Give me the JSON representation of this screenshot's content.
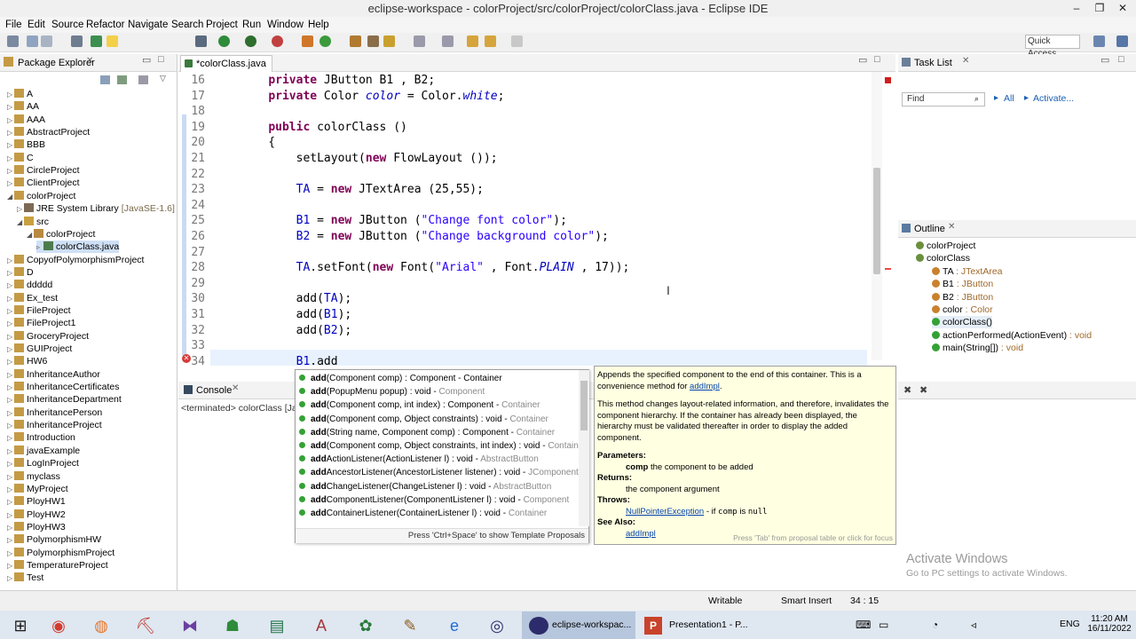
{
  "window": {
    "title": "eclipse-workspace - colorProject/src/colorProject/colorClass.java - Eclipse IDE",
    "minimize": "–",
    "maximize": "❐",
    "close": "✕"
  },
  "menu": [
    "File",
    "Edit",
    "Source",
    "Refactor",
    "Navigate",
    "Search",
    "Project",
    "Run",
    "Window",
    "Help"
  ],
  "quick_access": "Quick Access",
  "package_explorer": {
    "title": "Package Explorer",
    "items": [
      {
        "label": "A",
        "indent": 0,
        "kind": "project"
      },
      {
        "label": "AA",
        "indent": 0,
        "kind": "project"
      },
      {
        "label": "AAA",
        "indent": 0,
        "kind": "project"
      },
      {
        "label": "AbstractProject",
        "indent": 0,
        "kind": "project"
      },
      {
        "label": "BBB",
        "indent": 0,
        "kind": "project"
      },
      {
        "label": "C",
        "indent": 0,
        "kind": "project"
      },
      {
        "label": "CircleProject",
        "indent": 0,
        "kind": "project"
      },
      {
        "label": "ClientProject",
        "indent": 0,
        "kind": "project"
      },
      {
        "label": "colorProject",
        "indent": 0,
        "kind": "project",
        "open": true
      },
      {
        "label": "JRE System Library",
        "suffix": "[JavaSE-1.6]",
        "indent": 1,
        "kind": "lib"
      },
      {
        "label": "src",
        "indent": 1,
        "kind": "src",
        "open": true
      },
      {
        "label": "colorProject",
        "indent": 2,
        "kind": "pkg",
        "open": true
      },
      {
        "label": "colorClass.java",
        "indent": 3,
        "kind": "file"
      },
      {
        "label": "CopyofPolymorphismProject",
        "indent": 0,
        "kind": "project"
      },
      {
        "label": "D",
        "indent": 0,
        "kind": "project"
      },
      {
        "label": "ddddd",
        "indent": 0,
        "kind": "project"
      },
      {
        "label": "Ex_test",
        "indent": 0,
        "kind": "project"
      },
      {
        "label": "FileProject",
        "indent": 0,
        "kind": "project"
      },
      {
        "label": "FileProject1",
        "indent": 0,
        "kind": "project"
      },
      {
        "label": "GroceryProject",
        "indent": 0,
        "kind": "project"
      },
      {
        "label": "GUIProject",
        "indent": 0,
        "kind": "project"
      },
      {
        "label": "HW6",
        "indent": 0,
        "kind": "project"
      },
      {
        "label": "InheritanceAuthor",
        "indent": 0,
        "kind": "project"
      },
      {
        "label": "InheritanceCertificates",
        "indent": 0,
        "kind": "project"
      },
      {
        "label": "InheritanceDepartment",
        "indent": 0,
        "kind": "project"
      },
      {
        "label": "InheritancePerson",
        "indent": 0,
        "kind": "project"
      },
      {
        "label": "InheritanceProject",
        "indent": 0,
        "kind": "project"
      },
      {
        "label": "Introduction",
        "indent": 0,
        "kind": "project"
      },
      {
        "label": "javaExample",
        "indent": 0,
        "kind": "project"
      },
      {
        "label": "LogInProject",
        "indent": 0,
        "kind": "project"
      },
      {
        "label": "myclass",
        "indent": 0,
        "kind": "project"
      },
      {
        "label": "MyProject",
        "indent": 0,
        "kind": "project"
      },
      {
        "label": "PloyHW1",
        "indent": 0,
        "kind": "project"
      },
      {
        "label": "PloyHW2",
        "indent": 0,
        "kind": "project"
      },
      {
        "label": "PloyHW3",
        "indent": 0,
        "kind": "project"
      },
      {
        "label": "PolymorphismHW",
        "indent": 0,
        "kind": "project"
      },
      {
        "label": "PolymorphismProject",
        "indent": 0,
        "kind": "project"
      },
      {
        "label": "TemperatureProject",
        "indent": 0,
        "kind": "project"
      },
      {
        "label": "Test",
        "indent": 0,
        "kind": "project"
      }
    ]
  },
  "editor": {
    "tab": "*colorClass.java",
    "lines": [
      {
        "n": "16",
        "html": "    <span class='kw'>private</span> JButton B1 , B2;"
      },
      {
        "n": "17",
        "html": "    <span class='kw'>private</span> Color <span class='fld'>color</span> = Color.<span class='fld'>white</span>;"
      },
      {
        "n": "18",
        "html": ""
      },
      {
        "n": "19",
        "html": "    <span class='kw'>public</span> colorClass ()"
      },
      {
        "n": "20",
        "html": "    {"
      },
      {
        "n": "21",
        "html": "        setLayout(<span class='kw'>new</span> FlowLayout ());"
      },
      {
        "n": "22",
        "html": ""
      },
      {
        "n": "23",
        "html": "        <span class='fld' style='font-style:normal'>TA</span> = <span class='kw'>new</span> JTextArea (25,55);"
      },
      {
        "n": "24",
        "html": ""
      },
      {
        "n": "25",
        "html": "        <span class='fld' style='font-style:normal'>B1</span> = <span class='kw'>new</span> JButton (<span class='str'>\"Change font color\"</span>);"
      },
      {
        "n": "26",
        "html": "        <span class='fld' style='font-style:normal'>B2</span> = <span class='kw'>new</span> JButton (<span class='str'>\"Change background color\"</span>);"
      },
      {
        "n": "27",
        "html": ""
      },
      {
        "n": "28",
        "html": "        <span class='fld' style='font-style:normal'>TA</span>.setFont(<span class='kw'>new</span> Font(<span class='str'>\"Arial\"</span> , Font.<span class='fld'>PLAIN</span> , 17));"
      },
      {
        "n": "29",
        "html": ""
      },
      {
        "n": "30",
        "html": "        add(<span class='fld' style='font-style:normal'>TA</span>);"
      },
      {
        "n": "31",
        "html": "        add(<span class='fld' style='font-style:normal'>B1</span>);"
      },
      {
        "n": "32",
        "html": "        add(<span class='fld' style='font-style:normal'>B2</span>);"
      },
      {
        "n": "33",
        "html": ""
      },
      {
        "n": "34",
        "html": "        <span class='fld' style='font-style:normal'>B1</span>.add"
      }
    ]
  },
  "console": {
    "title": "Console",
    "status": "<terminated> colorClass [Jav"
  },
  "task_list": {
    "title": "Task List",
    "find_placeholder": "Find",
    "all": "All",
    "activate": "Activate..."
  },
  "outline": {
    "title": "Outline",
    "items": [
      {
        "label": "colorProject",
        "type": "",
        "indent": 0
      },
      {
        "label": "colorClass",
        "type": "",
        "indent": 0
      },
      {
        "label": "TA",
        "type": " : JTextArea",
        "indent": 1
      },
      {
        "label": "B1",
        "type": " : JButton",
        "indent": 1
      },
      {
        "label": "B2",
        "type": " : JButton",
        "indent": 1
      },
      {
        "label": "color",
        "type": " : Color",
        "indent": 1
      },
      {
        "label": "colorClass()",
        "type": "",
        "indent": 1
      },
      {
        "label": "actionPerformed(ActionEvent)",
        "type": " : void",
        "indent": 1
      },
      {
        "label": "main(String[])",
        "type": " : void",
        "indent": 1
      }
    ]
  },
  "content_assist": {
    "proposals": [
      {
        "b": "add",
        "rest": "(Component comp) : Component - Container",
        "typ": ""
      },
      {
        "b": "add",
        "rest": "(PopupMenu popup) : void - ",
        "typ": "Component"
      },
      {
        "b": "add",
        "rest": "(Component comp, int index) : Component - ",
        "typ": "Container"
      },
      {
        "b": "add",
        "rest": "(Component comp, Object constraints) : void - ",
        "typ": "Container"
      },
      {
        "b": "add",
        "rest": "(String name, Component comp) : Component - ",
        "typ": "Container"
      },
      {
        "b": "add",
        "rest": "(Component comp, Object constraints, int index) : void - ",
        "typ": "Container"
      },
      {
        "b": "add",
        "rest": "ActionListener(ActionListener l) : void - ",
        "typ": "AbstractButton"
      },
      {
        "b": "add",
        "rest": "AncestorListener(AncestorListener listener) : void - ",
        "typ": "JComponent"
      },
      {
        "b": "add",
        "rest": "ChangeListener(ChangeListener l) : void - ",
        "typ": "AbstractButton"
      },
      {
        "b": "add",
        "rest": "ComponentListener(ComponentListener l) : void - ",
        "typ": "Component"
      },
      {
        "b": "add",
        "rest": "ContainerListener(ContainerListener l) : void - ",
        "typ": "Container"
      }
    ],
    "footer": "Press 'Ctrl+Space' to show Template Proposals"
  },
  "javadoc": {
    "p1": "Appends the specified component to the end of this container. This is a convenience method for ",
    "p1_link": "addImpl",
    "p2": "This method changes layout-related information, and therefore, invalidates the component hierarchy. If the container has already been displayed, the hierarchy must be validated thereafter in order to display the added component.",
    "params_h": "Parameters:",
    "param": "comp",
    "param_desc": " the component to be added",
    "returns_h": "Returns:",
    "returns": "the component argument",
    "throws_h": "Throws:",
    "throws_link": "NullPointerException",
    "throws_desc": " - if ",
    "throws_code1": "comp",
    "throws_is": " is ",
    "throws_code2": "null",
    "see_h": "See Also:",
    "see_link": "addImpl",
    "footer": "Press 'Tab' from proposal table or click for focus"
  },
  "status": {
    "writable": "Writable",
    "insert": "Smart Insert",
    "pos": "34 : 15"
  },
  "watermark": {
    "l1": "Activate Windows",
    "l2": "Go to PC settings to activate Windows."
  },
  "taskbar": {
    "eclipse": "eclipse-workspac...",
    "ppt": "Presentation1 - P...",
    "lang": "ENG",
    "time": "11:20 AM",
    "date": "16/11/2022"
  }
}
